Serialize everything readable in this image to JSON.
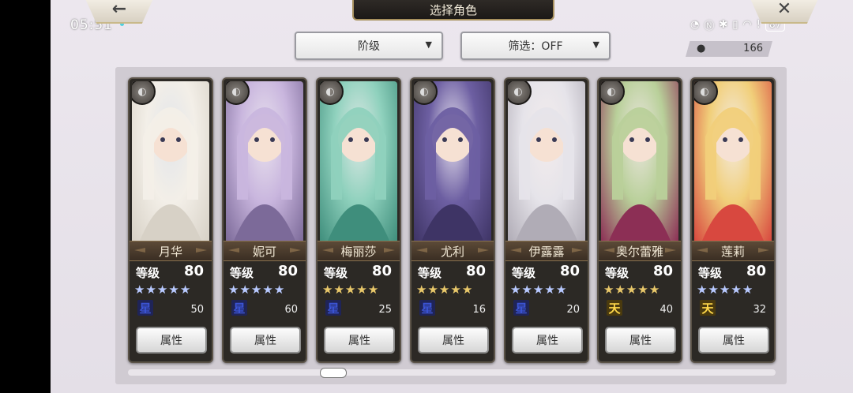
{
  "status_bar": {
    "time": "05:51",
    "battery": "87"
  },
  "header": {
    "title": "选择角色",
    "back_icon": "←",
    "close_icon": "✕"
  },
  "filters": {
    "class_label": "阶级",
    "filter_label": "筛选：OFF"
  },
  "count": "166",
  "level_label": "等级",
  "attr_label": "属性",
  "colors": {
    "sky_star": "#b8c9ff",
    "gold_star": "#e9c86a",
    "accent_frame": "#a8915e"
  },
  "characters": [
    {
      "name": "月华",
      "level": "80",
      "star_type": "sky",
      "rank": "星",
      "rank_type": "sky",
      "value": "50"
    },
    {
      "name": "妮可",
      "level": "80",
      "star_type": "sky",
      "rank": "星",
      "rank_type": "sky",
      "value": "60"
    },
    {
      "name": "梅丽莎",
      "level": "80",
      "star_type": "gold",
      "rank": "星",
      "rank_type": "sky",
      "value": "25"
    },
    {
      "name": "尤利",
      "level": "80",
      "star_type": "gold",
      "rank": "星",
      "rank_type": "sky",
      "value": "16"
    },
    {
      "name": "伊露露",
      "level": "80",
      "star_type": "sky",
      "rank": "星",
      "rank_type": "sky",
      "value": "20"
    },
    {
      "name": "奥尔蕾雅",
      "level": "80",
      "star_type": "gold",
      "rank": "天",
      "rank_type": "heaven",
      "value": "40"
    },
    {
      "name": "莲莉",
      "level": "80",
      "star_type": "sky",
      "rank": "天",
      "rank_type": "heaven",
      "value": "32"
    }
  ]
}
